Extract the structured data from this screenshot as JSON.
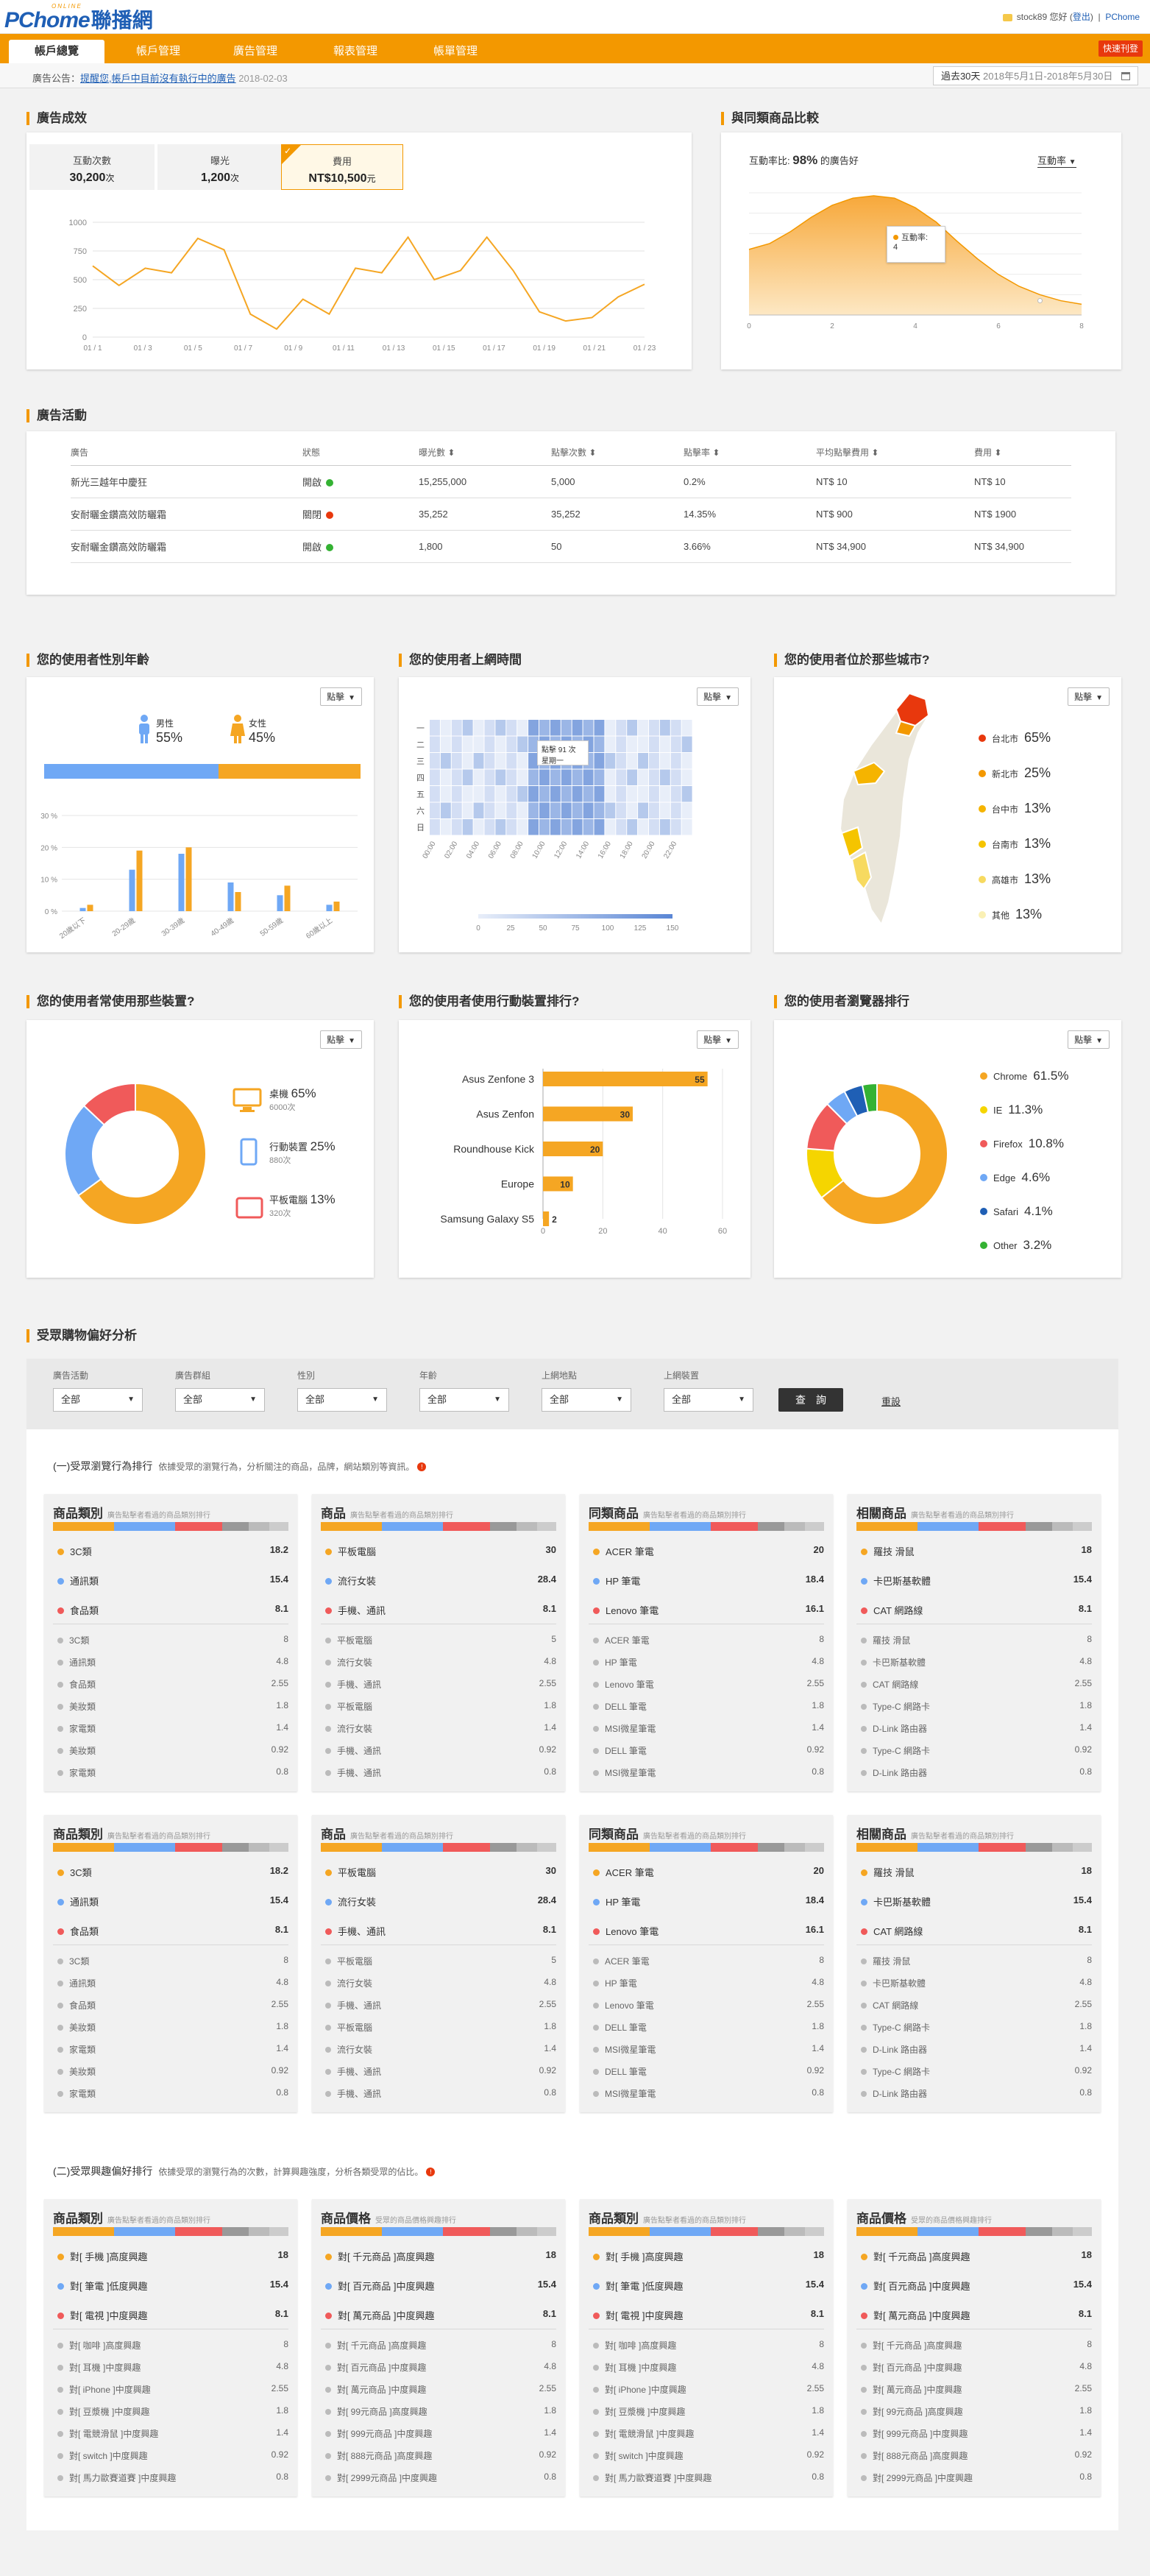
{
  "header": {
    "logo_main": "PChome",
    "logo_zh": "聯播網",
    "logo_small": "ONLINE",
    "user": "stock89",
    "hello": "您好",
    "logout": "登出",
    "pchome_link": "PChome"
  },
  "nav": {
    "tabs": [
      "帳戶總覽",
      "帳戶管理",
      "廣告管理",
      "報表管理",
      "帳單管理"
    ],
    "active": 0,
    "quick_btn": "快速刊登"
  },
  "notice": {
    "label": "廣告公告：",
    "link": "提醒您,帳戶中目前沒有執行中的廣告",
    "date": "2018-02-03",
    "range_label": "過去30天",
    "range": "2018年5月1日-2018年5月30日"
  },
  "performance": {
    "title": "廣告成效",
    "kpis": [
      {
        "label": "互動次數",
        "value": "30,200",
        "unit": "次"
      },
      {
        "label": "曝光",
        "value": "1,200",
        "unit": "次"
      },
      {
        "label": "費用",
        "value": "NT$10,500",
        "unit": "元"
      }
    ],
    "chart_data": {
      "type": "line",
      "x": [
        "01 / 1",
        "01 / 3",
        "01 / 5",
        "01 / 7",
        "01 / 9",
        "01 / 11",
        "01 / 13",
        "01 / 15",
        "01 / 17",
        "01 / 19",
        "01 / 21",
        "01 / 23"
      ],
      "yticks": [
        "0",
        "250",
        "500",
        "750",
        "1000"
      ],
      "ylim": [
        0,
        1000
      ],
      "values": [
        620,
        450,
        600,
        560,
        860,
        760,
        200,
        70,
        330,
        200,
        600,
        560,
        870,
        500,
        580,
        870,
        580,
        220,
        140,
        170,
        350,
        460
      ],
      "color": "#f5a623"
    }
  },
  "compare": {
    "title": "與同類商品比較",
    "label_prefix": "互動率比:",
    "percent": "98%",
    "label_suffix": "的廣告好",
    "dropdown": "互動率",
    "tooltip_label": "互動率:",
    "tooltip_value": "4",
    "xticks": [
      "0",
      "2",
      "4",
      "6",
      "8"
    ],
    "chart_data": {
      "type": "area",
      "x": [
        0,
        0.5,
        1,
        1.5,
        2,
        2.5,
        3,
        3.5,
        4,
        4.5,
        5,
        5.5,
        6,
        6.5,
        7,
        7.5,
        8
      ],
      "values": [
        0.55,
        0.6,
        0.7,
        0.82,
        0.92,
        0.98,
        1.0,
        0.98,
        0.9,
        0.78,
        0.62,
        0.47,
        0.34,
        0.24,
        0.17,
        0.12,
        0.09
      ]
    }
  },
  "activity": {
    "title": "廣告活動",
    "headers": [
      "廣告",
      "狀態",
      "曝光數",
      "點擊次數",
      "點擊率",
      "平均點擊費用",
      "費用"
    ],
    "rows": [
      [
        "新光三越年中慶狂",
        "開啟",
        "15,255,000",
        "5,000",
        "0.2%",
        "NT$ 10",
        "NT$ 10"
      ],
      [
        "安耐曬金鑽高效防曬霜",
        "關閉",
        "35,252",
        "35,252",
        "14.35%",
        "NT$ 900",
        "NT$ 1900"
      ],
      [
        "安耐曬金鑽高效防曬霜",
        "開啟",
        "1,800",
        "50",
        "3.66%",
        "NT$ 34,900",
        "NT$ 34,900"
      ]
    ],
    "status_colors": [
      "#34b233",
      "#e8380d",
      "#34b233"
    ]
  },
  "gender": {
    "title": "您的使用者性別年齡",
    "dropdown": "點擊",
    "male_label": "男性",
    "male_pct": "55%",
    "female_label": "女性",
    "female_pct": "45%",
    "chart_data": {
      "type": "bar",
      "categories": [
        "20歲以下",
        "20-29歲",
        "30-39歲",
        "40-49歲",
        "50-59歲",
        "60歲以上"
      ],
      "yticks": [
        "0 %",
        "10 %",
        "20 %",
        "30 %"
      ],
      "ylim": [
        0,
        30
      ],
      "series": [
        {
          "name": "男性",
          "values": [
            1,
            13,
            18,
            9,
            5,
            2
          ],
          "color": "#6fa8f5"
        },
        {
          "name": "女性",
          "values": [
            2,
            19,
            20,
            6,
            8,
            3
          ],
          "color": "#f5a623"
        }
      ]
    }
  },
  "online": {
    "title": "您的使用者上網時間",
    "dropdown": "點擊",
    "rows": [
      "一",
      "二",
      "三",
      "四",
      "五",
      "六",
      "日"
    ],
    "xlabels": [
      "00:00",
      "02:00",
      "04:00",
      "06:00",
      "08:00",
      "10:00",
      "12:00",
      "14:00",
      "16:00",
      "18:00",
      "20:00",
      "22:00"
    ],
    "scale": [
      "0",
      "25",
      "50",
      "75",
      "100",
      "125",
      "150"
    ],
    "tooltip": "點擊 91 次",
    "tooltip2": "星期一"
  },
  "city": {
    "title": "您的使用者位於那些城市?",
    "dropdown": "點擊",
    "items": [
      {
        "name": "台北市",
        "pct": "65%",
        "color": "#e8380d"
      },
      {
        "name": "新北市",
        "pct": "25%",
        "color": "#f39800"
      },
      {
        "name": "台中市",
        "pct": "13%",
        "color": "#f5b400"
      },
      {
        "name": "台南市",
        "pct": "13%",
        "color": "#f5c400"
      },
      {
        "name": "高雄市",
        "pct": "13%",
        "color": "#f7da60"
      },
      {
        "name": "其他",
        "pct": "13%",
        "color": "#faf0b4"
      }
    ]
  },
  "device": {
    "title": "您的使用者常使用那些裝置?",
    "dropdown": "點擊",
    "items": [
      {
        "name": "桌機",
        "pct": "65%",
        "count": "6000次",
        "color": "#f5a623"
      },
      {
        "name": "行動裝置",
        "pct": "25%",
        "count": "880次",
        "color": "#6fa8f5"
      },
      {
        "name": "平板電腦",
        "pct": "13%",
        "count": "320次",
        "color": "#f05a5a"
      }
    ],
    "chart_data": {
      "type": "pie",
      "values": [
        65,
        22,
        13
      ],
      "labels": [
        "桌機",
        "行動裝置",
        "平板電腦"
      ]
    }
  },
  "mobile": {
    "title": "您的使用者使用行動裝置排行?",
    "dropdown": "點擊",
    "chart_data": {
      "type": "bar",
      "categories": [
        "Asus Zenfone 3",
        "Asus Zenfon",
        "Roundhouse Kick",
        "Europe",
        "Samsung Galaxy S5"
      ],
      "values": [
        55,
        30,
        20,
        10,
        2
      ],
      "xticks": [
        "0",
        "20",
        "40",
        "60"
      ],
      "xlim": [
        0,
        60
      ]
    }
  },
  "browser": {
    "title": "您的使用者瀏覽器排行",
    "dropdown": "點擊",
    "items": [
      {
        "name": "Chrome",
        "pct": "61.5%",
        "color": "#f5a623"
      },
      {
        "name": "IE",
        "pct": "11.3%",
        "color": "#f5d500"
      },
      {
        "name": "Firefox",
        "pct": "10.8%",
        "color": "#f05a5a"
      },
      {
        "name": "Edge",
        "pct": "4.6%",
        "color": "#6fa8f5"
      },
      {
        "name": "Safari",
        "pct": "4.1%",
        "color": "#1f5fb5"
      },
      {
        "name": "Other",
        "pct": "3.2%",
        "color": "#34b233"
      }
    ],
    "chart_data": {
      "type": "pie",
      "values": [
        61.5,
        11.3,
        10.8,
        4.6,
        4.1,
        3.2
      ],
      "labels": [
        "Chrome",
        "IE",
        "Firefox",
        "Edge",
        "Safari",
        "Other"
      ]
    }
  },
  "pref": {
    "title": "受眾購物偏好分析",
    "filters": [
      {
        "label": "廣告活動",
        "value": "全部"
      },
      {
        "label": "廣告群組",
        "value": "全部"
      },
      {
        "label": "性別",
        "value": "全部"
      },
      {
        "label": "年齡",
        "value": "全部"
      },
      {
        "label": "上網地點",
        "value": "全部"
      },
      {
        "label": "上網裝置",
        "value": "全部"
      }
    ],
    "query": "查　詢",
    "reset": "重設",
    "sec1_title": "(一)受眾瀏覽行為排行",
    "sec1_desc": "依據受眾的瀏覽行為，分析關注的商品，品牌，網站類別等資訊。",
    "sec2_title": "(二)受眾興趣偏好排行",
    "sec2_desc": "依據受眾的瀏覽行為的次數，計算興趣強度，分析各類受眾的佔比。",
    "bar_colors": [
      "#f5a623",
      "#6fa8f5",
      "#f05a5a",
      "#999999",
      "#bbbbbb",
      "#cccccc"
    ],
    "top_colors": [
      "#f5a623",
      "#6fa8f5",
      "#f05a5a"
    ],
    "cards1": [
      {
        "title": "商品類別",
        "sub": "廣告點擊者看過的商品類別排行",
        "top": [
          [
            "3C類",
            "18.2"
          ],
          [
            "通訊類",
            "15.4"
          ],
          [
            "食品類",
            "8.1"
          ]
        ],
        "rest": [
          [
            "3C類",
            "8"
          ],
          [
            "通訊類",
            "4.8"
          ],
          [
            "食品類",
            "2.55"
          ],
          [
            "美妝類",
            "1.8"
          ],
          [
            "家電類",
            "1.4"
          ],
          [
            "美妝類",
            "0.92"
          ],
          [
            "家電類",
            "0.8"
          ]
        ]
      },
      {
        "title": "商品",
        "sub": "廣告點擊者看過的商品類別排行",
        "top": [
          [
            "平板電腦",
            "30"
          ],
          [
            "流行女裝",
            "28.4"
          ],
          [
            "手機、通訊",
            "8.1"
          ]
        ],
        "rest": [
          [
            "平板電腦",
            "5"
          ],
          [
            "流行女裝",
            "4.8"
          ],
          [
            "手機、通訊",
            "2.55"
          ],
          [
            "平板電腦",
            "1.8"
          ],
          [
            "流行女裝",
            "1.4"
          ],
          [
            "手機、通訊",
            "0.92"
          ],
          [
            "手機、通訊",
            "0.8"
          ]
        ]
      },
      {
        "title": "同類商品",
        "sub": "廣告點擊者看過的商品類別排行",
        "top": [
          [
            "ACER 筆電",
            "20"
          ],
          [
            "HP 筆電",
            "18.4"
          ],
          [
            "Lenovo 筆電",
            "16.1"
          ]
        ],
        "rest": [
          [
            "ACER 筆電",
            "8"
          ],
          [
            "HP 筆電",
            "4.8"
          ],
          [
            "Lenovo 筆電",
            "2.55"
          ],
          [
            "DELL 筆電",
            "1.8"
          ],
          [
            "MSI微星筆電",
            "1.4"
          ],
          [
            "DELL 筆電",
            "0.92"
          ],
          [
            "MSI微星筆電",
            "0.8"
          ]
        ]
      },
      {
        "title": "相關商品",
        "sub": "廣告點擊者看過的商品類別排行",
        "top": [
          [
            "羅技 滑鼠",
            "18"
          ],
          [
            "卡巴斯基軟體",
            "15.4"
          ],
          [
            "CAT 網路線",
            "8.1"
          ]
        ],
        "rest": [
          [
            "羅技 滑鼠",
            "8"
          ],
          [
            "卡巴斯基軟體",
            "4.8"
          ],
          [
            "CAT 網路線",
            "2.55"
          ],
          [
            "Type-C 網路卡",
            "1.8"
          ],
          [
            "D-Link 路由器",
            "1.4"
          ],
          [
            "Type-C 網路卡",
            "0.92"
          ],
          [
            "D-Link 路由器",
            "0.8"
          ]
        ]
      }
    ],
    "cards2": [
      {
        "title": "商品類別",
        "sub": "廣告點擊者看過的商品類別排行",
        "top": [
          [
            "對[ 手機 ]高度興趣",
            "18"
          ],
          [
            "對[ 筆電 ]低度興趣",
            "15.4"
          ],
          [
            "對[ 電視 ]中度興趣",
            "8.1"
          ]
        ],
        "rest": [
          [
            "對[ 咖啡 ]高度興趣",
            "8"
          ],
          [
            "對[ 耳機 ]中度興趣",
            "4.8"
          ],
          [
            "對[ iPhone ]中度興趣",
            "2.55"
          ],
          [
            "對[ 豆漿機 ]中度興趣",
            "1.8"
          ],
          [
            "對[ 電競滑鼠 ]中度興趣",
            "1.4"
          ],
          [
            "對[ switch ]中度興趣",
            "0.92"
          ],
          [
            "對[ 馬力歐賽道賽 ]中度興趣",
            "0.8"
          ]
        ]
      },
      {
        "title": "商品價格",
        "sub": "受眾的商品價格興趣排行",
        "top": [
          [
            "對[ 千元商品 ]高度興趣",
            "18"
          ],
          [
            "對[ 百元商品 ]中度興趣",
            "15.4"
          ],
          [
            "對[ 萬元商品 ]中度興趣",
            "8.1"
          ]
        ],
        "rest": [
          [
            "對[ 千元商品 ]高度興趣",
            "8"
          ],
          [
            "對[ 百元商品 ]中度興趣",
            "4.8"
          ],
          [
            "對[ 萬元商品 ]中度興趣",
            "2.55"
          ],
          [
            "對[ 99元商品 ]高度興趣",
            "1.8"
          ],
          [
            "對[ 999元商品 ]中度興趣",
            "1.4"
          ],
          [
            "對[ 888元商品 ]高度興趣",
            "0.92"
          ],
          [
            "對[ 2999元商品 ]中度興趣",
            "0.8"
          ]
        ]
      },
      {
        "title": "商品類別",
        "sub": "廣告點擊者看過的商品類別排行",
        "top": [
          [
            "對[ 手機 ]高度興趣",
            "18"
          ],
          [
            "對[ 筆電 ]低度興趣",
            "15.4"
          ],
          [
            "對[ 電視 ]中度興趣",
            "8.1"
          ]
        ],
        "rest": [
          [
            "對[ 咖啡 ]高度興趣",
            "8"
          ],
          [
            "對[ 耳機 ]中度興趣",
            "4.8"
          ],
          [
            "對[ iPhone ]中度興趣",
            "2.55"
          ],
          [
            "對[ 豆漿機 ]中度興趣",
            "1.8"
          ],
          [
            "對[ 電競滑鼠 ]中度興趣",
            "1.4"
          ],
          [
            "對[ switch ]中度興趣",
            "0.92"
          ],
          [
            "對[ 馬力歐賽道賽 ]中度興趣",
            "0.8"
          ]
        ]
      },
      {
        "title": "商品價格",
        "sub": "受眾的商品價格興趣排行",
        "top": [
          [
            "對[ 千元商品 ]高度興趣",
            "18"
          ],
          [
            "對[ 百元商品 ]中度興趣",
            "15.4"
          ],
          [
            "對[ 萬元商品 ]中度興趣",
            "8.1"
          ]
        ],
        "rest": [
          [
            "對[ 千元商品 ]高度興趣",
            "8"
          ],
          [
            "對[ 百元商品 ]中度興趣",
            "4.8"
          ],
          [
            "對[ 萬元商品 ]中度興趣",
            "2.55"
          ],
          [
            "對[ 99元商品 ]高度興趣",
            "1.8"
          ],
          [
            "對[ 999元商品 ]中度興趣",
            "1.4"
          ],
          [
            "對[ 888元商品 ]高度興趣",
            "0.92"
          ],
          [
            "對[ 2999元商品 ]中度興趣",
            "0.8"
          ]
        ]
      }
    ]
  }
}
